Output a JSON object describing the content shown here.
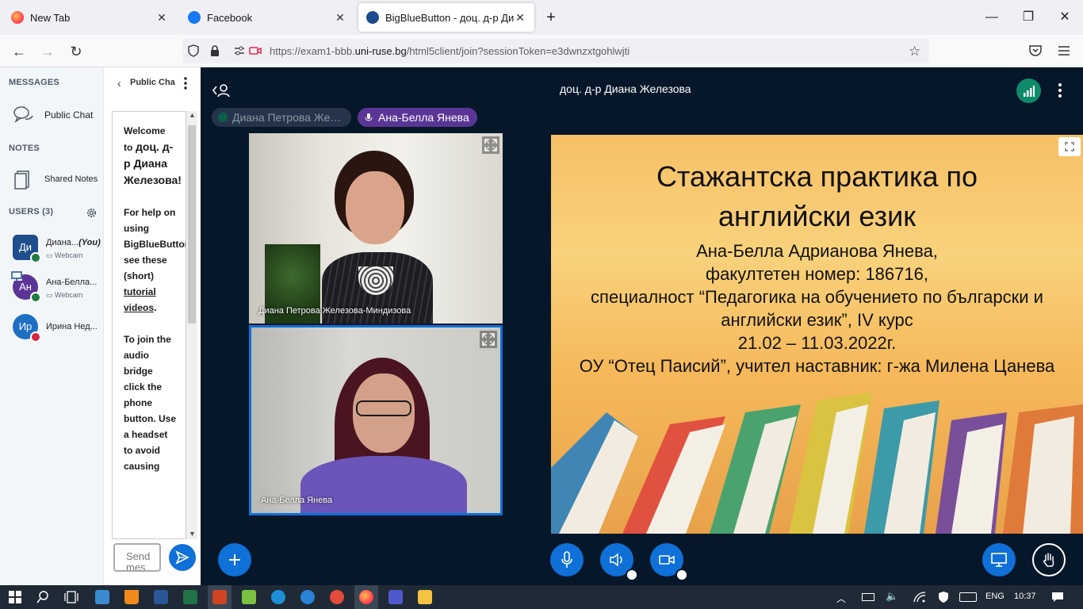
{
  "browser": {
    "tabs": [
      {
        "label": "New Tab"
      },
      {
        "label": "Facebook"
      },
      {
        "label": "BigBlueButton - доц. д-р Диана"
      }
    ],
    "url_prefix": "https://exam1-bbb.",
    "url_domain": "uni-ruse.bg",
    "url_path": "/html5client/join?sessionToken=e3dwnzxtgohlwjti"
  },
  "sidebar": {
    "messages_heading": "MESSAGES",
    "public_chat": "Public Chat",
    "notes_heading": "NOTES",
    "shared_notes": "Shared Notes",
    "users_heading": "USERS (3)",
    "users": [
      {
        "initials": "Ди",
        "name": "Диана...",
        "you": "(You)",
        "sub": "Webcam",
        "color": "#1e4e8c"
      },
      {
        "initials": "Ан",
        "name": "Ана-Белла...",
        "sub": "Webcam",
        "color": "#5b3596"
      },
      {
        "initials": "Ир",
        "name": "Ирина Нед...",
        "sub": "",
        "color": "#1d6fc4"
      }
    ]
  },
  "chat": {
    "title": "Public Cha",
    "message": {
      "welcome": "Welcome to",
      "host": "доц. д-р Диана Железова!",
      "help1": "For help on using BigBlueButton see these (short)",
      "link": "tutorial videos",
      "help2": ".",
      "join": "To join the audio bridge click the phone button. Use a headset to avoid causing"
    },
    "input_placeholder": "Send mes"
  },
  "meeting": {
    "title": "доц. д-р Диана Железова",
    "talkers": [
      {
        "name": "Диана Петрова Же…"
      },
      {
        "name": "Ана-Белла Янева"
      }
    ],
    "videos": [
      {
        "label": "Диана Петрова Железова-Миндизова"
      },
      {
        "label": "Ана-Белла Янева"
      }
    ]
  },
  "slide": {
    "title_line1": "Стажантска практика по",
    "title_line2": "английски език",
    "line1": "Ана-Белла Адрианова Янева,",
    "line2": "факултетен номер: 186716,",
    "line3": "специалност “Педагогика на обучението по български и",
    "line4": "английски език”, IV курс",
    "line5": "21.02 – 11.03.2022г.",
    "line6": "ОУ “Отец Паисий”, учител наставник: г-жа Милена Цанева"
  },
  "taskbar": {
    "lang": "ENG",
    "time": "10:37"
  },
  "colors": {
    "accent": "#0f70d7",
    "dark_bg": "#06172a",
    "talker_active": "#5b3596"
  }
}
